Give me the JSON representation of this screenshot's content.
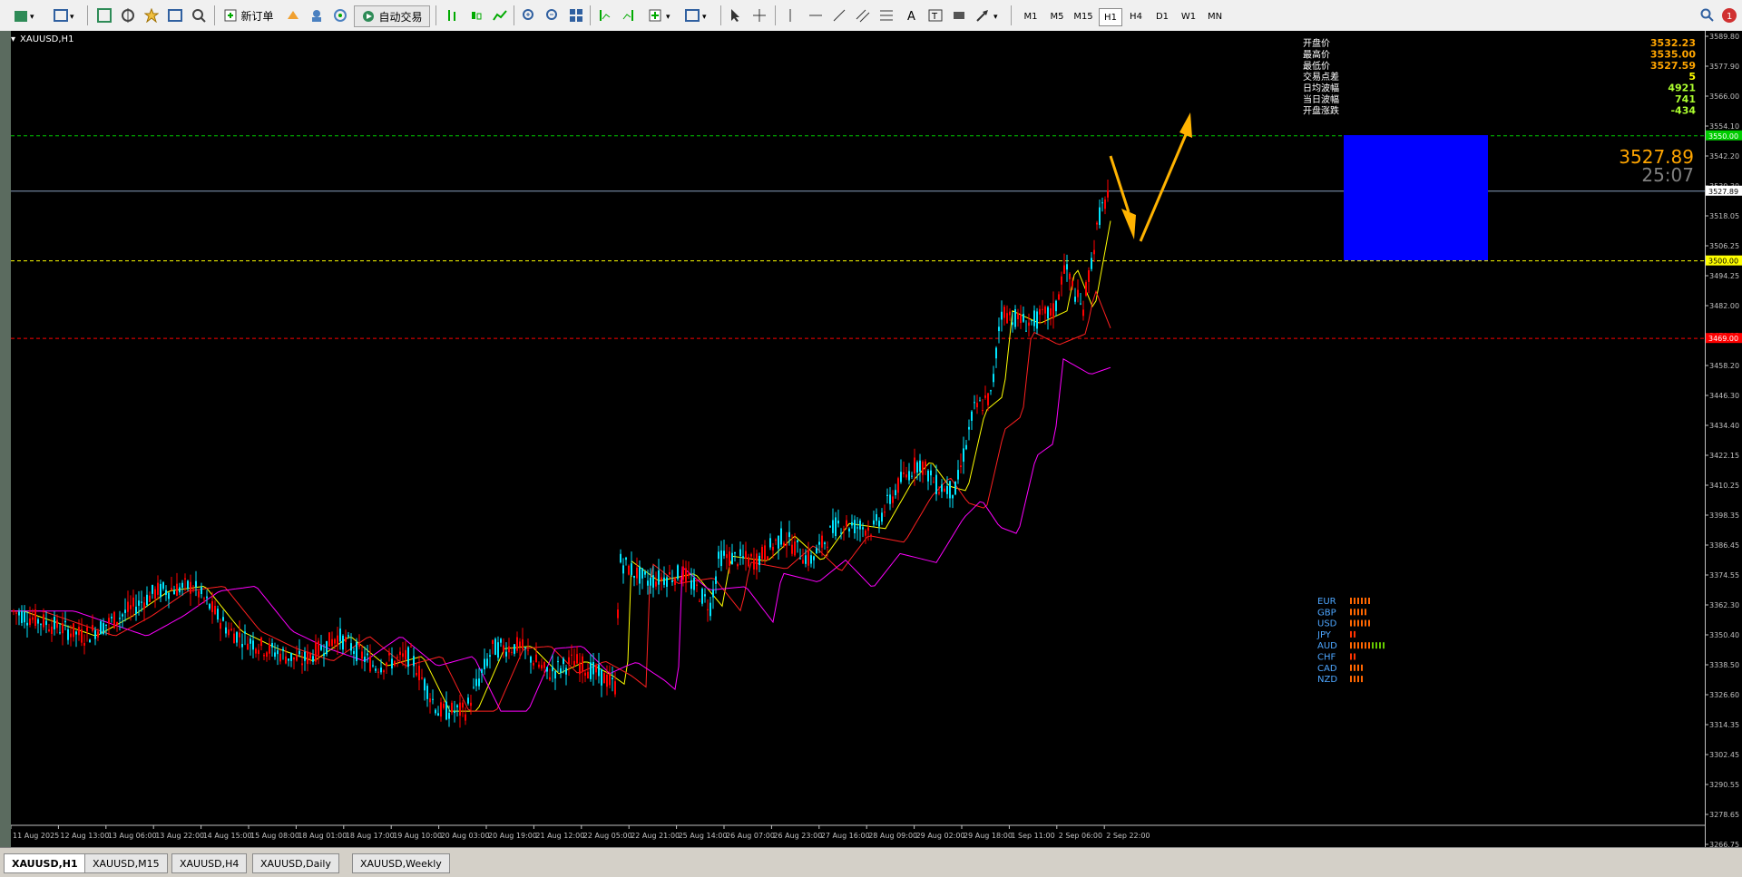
{
  "toolbar": {
    "new_order_label": "新订单",
    "auto_trade_label": "自动交易",
    "timeframes": [
      "M1",
      "M5",
      "M15",
      "H1",
      "H4",
      "D1",
      "W1",
      "MN"
    ],
    "active_timeframe": "H1",
    "alert_count": "1"
  },
  "chart": {
    "symbol": "XAUUSD,H1",
    "info_panel": [
      {
        "label": "开盘价",
        "value": "3532.23",
        "color": "#ffa500"
      },
      {
        "label": "最高价",
        "value": "3535.00",
        "color": "#ffa500"
      },
      {
        "label": "最低价",
        "value": "3527.59",
        "color": "#ffa500"
      },
      {
        "label": "交易点差",
        "value": "5",
        "color": "#ffff00"
      },
      {
        "label": "日均波幅",
        "value": "4921",
        "color": "#adff2f"
      },
      {
        "label": "当日波幅",
        "value": "741",
        "color": "#adff2f"
      },
      {
        "label": "开盘涨跌",
        "value": "-434",
        "color": "#adff2f"
      }
    ],
    "current_price": "3527.89",
    "countdown": "25:07",
    "price_axis": [
      "3589.80",
      "3577.90",
      "3566.00",
      "3554.10",
      "3542.20",
      "3530.30",
      "3518.05",
      "3506.25",
      "3494.25",
      "3482.00",
      "3470.25",
      "3458.20",
      "3446.30",
      "3434.40",
      "3422.15",
      "3410.25",
      "3398.35",
      "3386.45",
      "3374.55",
      "3362.30",
      "3350.40",
      "3338.50",
      "3326.60",
      "3314.35",
      "3302.45",
      "3290.55",
      "3278.65",
      "3266.75"
    ],
    "axis_price_label": "3527.89",
    "level_labels": [
      {
        "label": "3550.00",
        "color": "#00cc00"
      },
      {
        "label": "3500.00",
        "color": "#ffff00"
      },
      {
        "label": "3469.00",
        "color": "#ff0000"
      }
    ],
    "time_axis": [
      "11 Aug 2025",
      "12 Aug 13:00",
      "13 Aug 06:00",
      "13 Aug 22:00",
      "14 Aug 15:00",
      "15 Aug 08:00",
      "18 Aug 01:00",
      "18 Aug 17:00",
      "19 Aug 10:00",
      "20 Aug 03:00",
      "20 Aug 19:00",
      "21 Aug 12:00",
      "22 Aug 05:00",
      "22 Aug 21:00",
      "25 Aug 14:00",
      "26 Aug 07:00",
      "26 Aug 23:00",
      "27 Aug 16:00",
      "28 Aug 09:00",
      "29 Aug 02:00",
      "29 Aug 18:00",
      "1 Sep 11:00",
      "2 Sep 06:00",
      "2 Sep 22:00"
    ],
    "currency_strength": [
      {
        "name": "EUR",
        "bars": 6,
        "color": "#ff6600"
      },
      {
        "name": "GBP",
        "bars": 5,
        "color": "#ff6600"
      },
      {
        "name": "USD",
        "bars": 6,
        "color": "#ff6600"
      },
      {
        "name": "JPY",
        "bars": 2,
        "color": "#ff3300"
      },
      {
        "name": "AUD",
        "bars": 10,
        "color": "#ff6600"
      },
      {
        "name": "CHF",
        "bars": 2,
        "color": "#ff3300"
      },
      {
        "name": "CAD",
        "bars": 4,
        "color": "#ff6600"
      },
      {
        "name": "NZD",
        "bars": 4,
        "color": "#ff6600"
      }
    ]
  },
  "tabs": [
    "XAUUSD,H1",
    "XAUUSD,M15",
    "XAUUSD,H4",
    "XAUUSD,Daily",
    "XAUUSD,Weekly"
  ],
  "active_tab": "XAUUSD,H1"
}
